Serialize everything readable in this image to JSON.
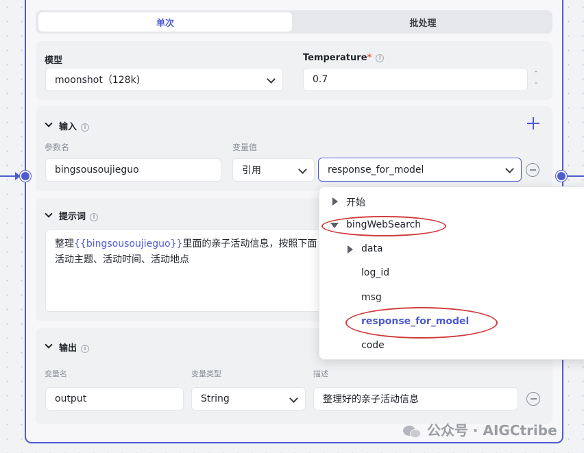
{
  "tabs": {
    "single": "单次",
    "batch": "批处理"
  },
  "model": {
    "label": "模型",
    "value": "moonshot（128k)"
  },
  "temperature": {
    "label": "Temperature",
    "required_mark": "*",
    "value": "0.7"
  },
  "input": {
    "title": "输入",
    "param_name_header": "参数名",
    "var_value_header": "变量值",
    "rows": [
      {
        "name": "bingsousoujieguo",
        "source_type": "引用",
        "reference": "response_for_model"
      }
    ]
  },
  "dropdown": {
    "items": [
      {
        "label": "开始",
        "expand": "collapsed"
      },
      {
        "label": "bingWebSearch",
        "expand": "expanded"
      },
      {
        "label": "data",
        "expand": "collapsed"
      },
      {
        "label": "log_id"
      },
      {
        "label": "msg"
      },
      {
        "label": "response_for_model",
        "selected": true
      },
      {
        "label": "code"
      }
    ]
  },
  "prompt": {
    "title": "提示词",
    "text_before": "整理",
    "variable": "{{bingsousoujieguo}}",
    "text_after": "里面的亲子活动信息，按照下面",
    "line2": "活动主题、活动时间、活动地点"
  },
  "output": {
    "title": "输出",
    "var_name_header": "变量名",
    "var_type_header": "变量类型",
    "desc_header": "描述",
    "rows": [
      {
        "name": "output",
        "type": "String",
        "description": "整理好的亲子活动信息"
      }
    ]
  },
  "watermark": "公众号 · AIGCtribe",
  "colors": {
    "accent": "#4e5bd1",
    "annotation": "#d03a3a"
  }
}
